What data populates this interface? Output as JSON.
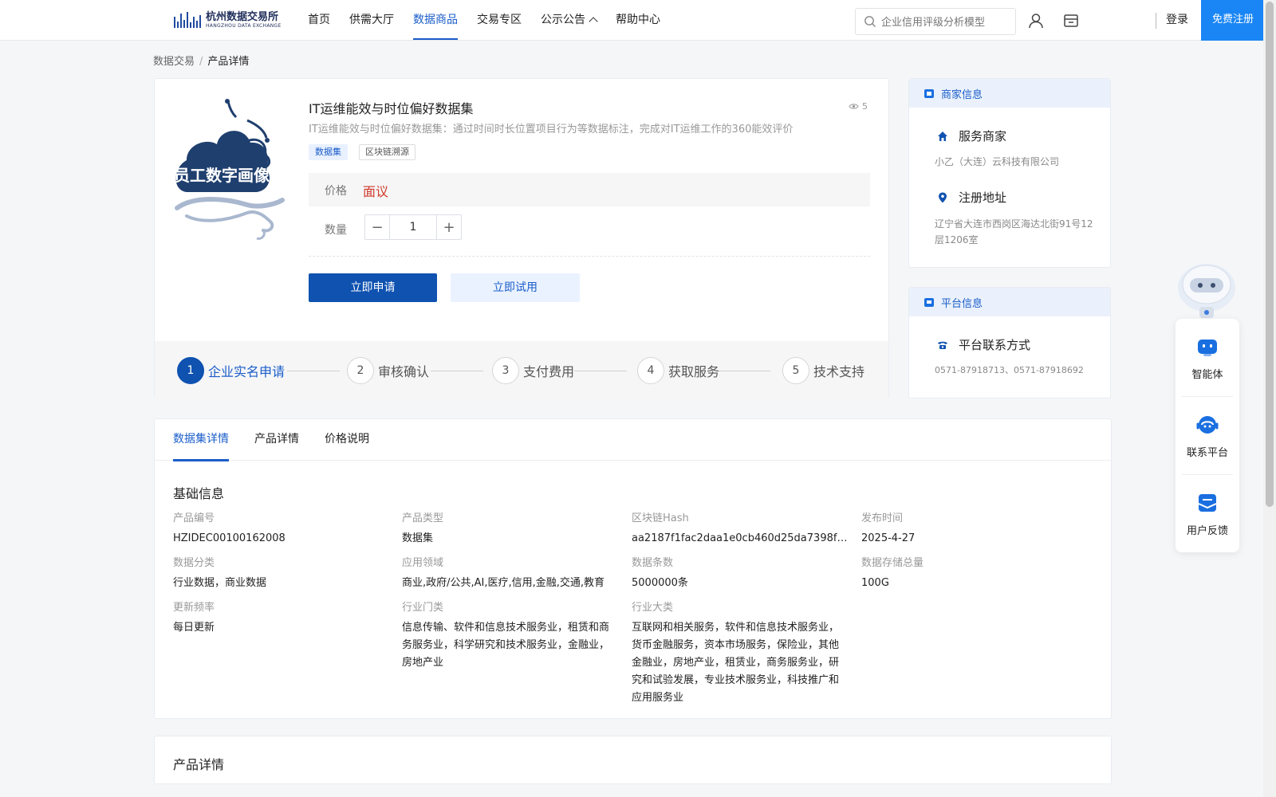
{
  "header": {
    "logo_cn": "杭州数据交易所",
    "logo_en": "HANGZHOU DATA EXCHANGE",
    "nav": [
      {
        "label": "首页"
      },
      {
        "label": "供需大厅"
      },
      {
        "label": "数据商品",
        "active": true
      },
      {
        "label": "交易专区"
      },
      {
        "label": "公示公告",
        "dropdown": true
      },
      {
        "label": "帮助中心"
      }
    ],
    "search_placeholder": "企业信用评级分析模型",
    "login": "登录",
    "register": "免费注册"
  },
  "breadcrumb": {
    "parent": "数据交易",
    "separator": "/",
    "current": "产品详情"
  },
  "product": {
    "image_text": "员工数字画像",
    "title": "IT运维能效与时位偏好数据集",
    "views": "5",
    "description": "IT运维能效与时位偏好数据集：通过时间时长位置项目行为等数据标注，完成对IT运维工作的360能效评价",
    "tags": [
      "数据集",
      "区块链溯源"
    ],
    "price_label": "价格",
    "price_value": "面议",
    "qty_label": "数量",
    "qty_value": "1",
    "qty_minus": "−",
    "qty_plus": "+",
    "apply_button": "立即申请",
    "trial_button": "立即试用"
  },
  "steps": [
    {
      "num": "1",
      "label": "企业实名申请",
      "active": true
    },
    {
      "num": "2",
      "label": "审核确认"
    },
    {
      "num": "3",
      "label": "支付费用"
    },
    {
      "num": "4",
      "label": "获取服务"
    },
    {
      "num": "5",
      "label": "技术支持"
    }
  ],
  "merchant": {
    "title": "商家信息",
    "service_label": "服务商家",
    "service_value": "小乙（大连）云科技有限公司",
    "address_label": "注册地址",
    "address_value": "辽宁省大连市西岗区海达北街91号12层1206室"
  },
  "platform": {
    "title": "平台信息",
    "contact_label": "平台联系方式",
    "contact_value": "0571-87918713、0571-87918692"
  },
  "tabs": [
    {
      "label": "数据集详情",
      "active": true
    },
    {
      "label": "产品详情"
    },
    {
      "label": "价格说明"
    }
  ],
  "basic_info": {
    "title": "基础信息",
    "fields": [
      {
        "key": "产品编号",
        "value": "HZIDEC00100162008"
      },
      {
        "key": "产品类型",
        "value": "数据集"
      },
      {
        "key": "区块链Hash",
        "value": "aa2187f1fac2daa1e0cb460d25da7398f95…"
      },
      {
        "key": "发布时间",
        "value": "2025-4-27"
      },
      {
        "key": "数据分类",
        "value": "行业数据，商业数据"
      },
      {
        "key": "应用领域",
        "value": "商业,政府/公共,AI,医疗,信用,金融,交通,教育"
      },
      {
        "key": "数据条数",
        "value": "5000000条"
      },
      {
        "key": "数据存储总量",
        "value": "100G"
      },
      {
        "key": "更新频率",
        "value": "每日更新"
      },
      {
        "key": "行业门类",
        "value": "信息传输、软件和信息技术服务业，租赁和商务服务业，科学研究和技术服务业，金融业，房地产业"
      },
      {
        "key": "行业大类",
        "value": "互联网和相关服务，软件和信息技术服务业，货币金融服务，资本市场服务，保险业，其他金融业，房地产业，租赁业，商务服务业，研究和试验发展，专业技术服务业，科技推广和应用服务业"
      }
    ]
  },
  "product_detail_section": {
    "title": "产品详情"
  },
  "float_panel": [
    {
      "label": "智能体",
      "icon": "agent-icon"
    },
    {
      "label": "联系平台",
      "icon": "headset-icon"
    },
    {
      "label": "用户反馈",
      "icon": "feedback-icon"
    }
  ],
  "colors": {
    "primary": "#0f52b0",
    "link": "#1a5dc9",
    "register": "#1a86f5",
    "price": "#d03a2a"
  }
}
